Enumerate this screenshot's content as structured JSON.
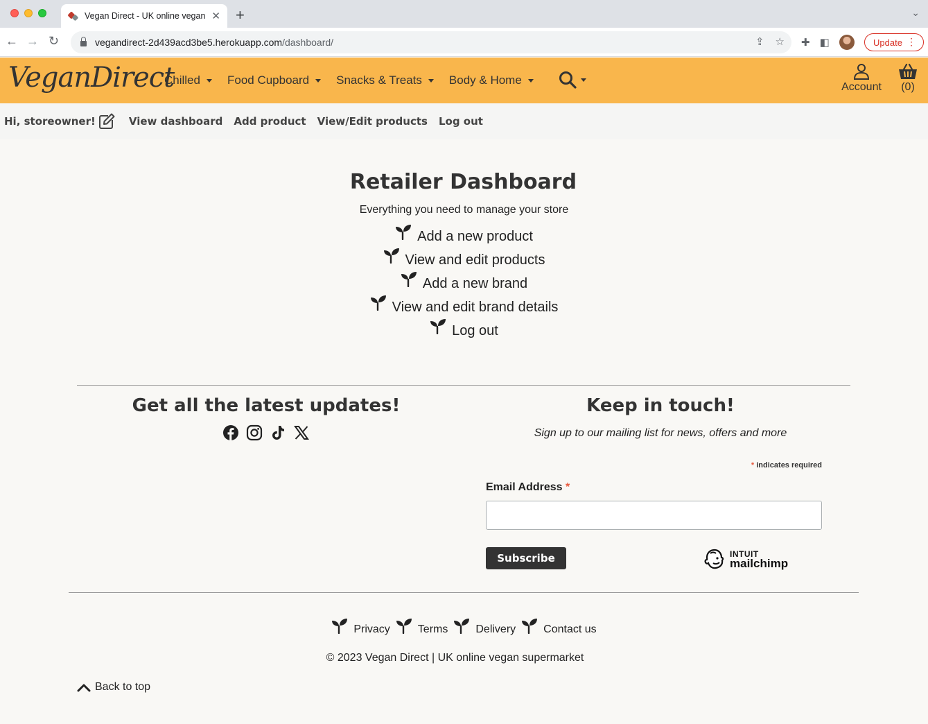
{
  "browser": {
    "tab_title": "Vegan Direct - UK online vegan supermarket",
    "tab_close": "✕",
    "new_tab": "+",
    "url_domain": "vegandirect-2d439acd3be5.herokuapp.com",
    "url_path": "/dashboard/",
    "update_label": "Update"
  },
  "header": {
    "logo": "VeganDirect",
    "nav": [
      {
        "label": "Chilled"
      },
      {
        "label": "Food Cupboard"
      },
      {
        "label": "Snacks & Treats"
      },
      {
        "label": "Body & Home"
      }
    ],
    "account_label": "Account",
    "basket_count": "(0)"
  },
  "subnav": {
    "greeting": "Hi, storeowner!",
    "links": [
      {
        "label": "View dashboard"
      },
      {
        "label": "Add product"
      },
      {
        "label": "View/Edit products"
      },
      {
        "label": "Log out"
      }
    ]
  },
  "main": {
    "title": "Retailer Dashboard",
    "subtitle": "Everything you need to manage your store",
    "items": [
      {
        "label": "Add a new product"
      },
      {
        "label": "View and edit products"
      },
      {
        "label": "Add a new brand"
      },
      {
        "label": "View and edit brand details"
      },
      {
        "label": "Log out"
      }
    ]
  },
  "footer": {
    "updates_title": "Get all the latest updates!",
    "socials": [
      "facebook-icon",
      "instagram-icon",
      "tiktok-icon",
      "x-icon"
    ],
    "touch_title": "Keep in touch!",
    "touch_tagline": "Sign up to our mailing list for news, offers and more",
    "required_star": "*",
    "required_note": " indicates required",
    "email_label": "Email Address",
    "email_value": "",
    "subscribe_label": "Subscribe",
    "mailchimp_intuit": "INTUIT",
    "mailchimp_name": "mailchimp",
    "links": [
      {
        "label": "Privacy"
      },
      {
        "label": "Terms"
      },
      {
        "label": "Delivery"
      },
      {
        "label": "Contact us"
      }
    ],
    "copyright": "© 2023 Vegan Direct | UK online vegan supermarket",
    "back_to_top": "Back to top"
  },
  "colors": {
    "header_bg": "#f9b64c",
    "page_bg": "#f9f8f5",
    "button_dark": "#333333",
    "required": "#e85c41"
  }
}
